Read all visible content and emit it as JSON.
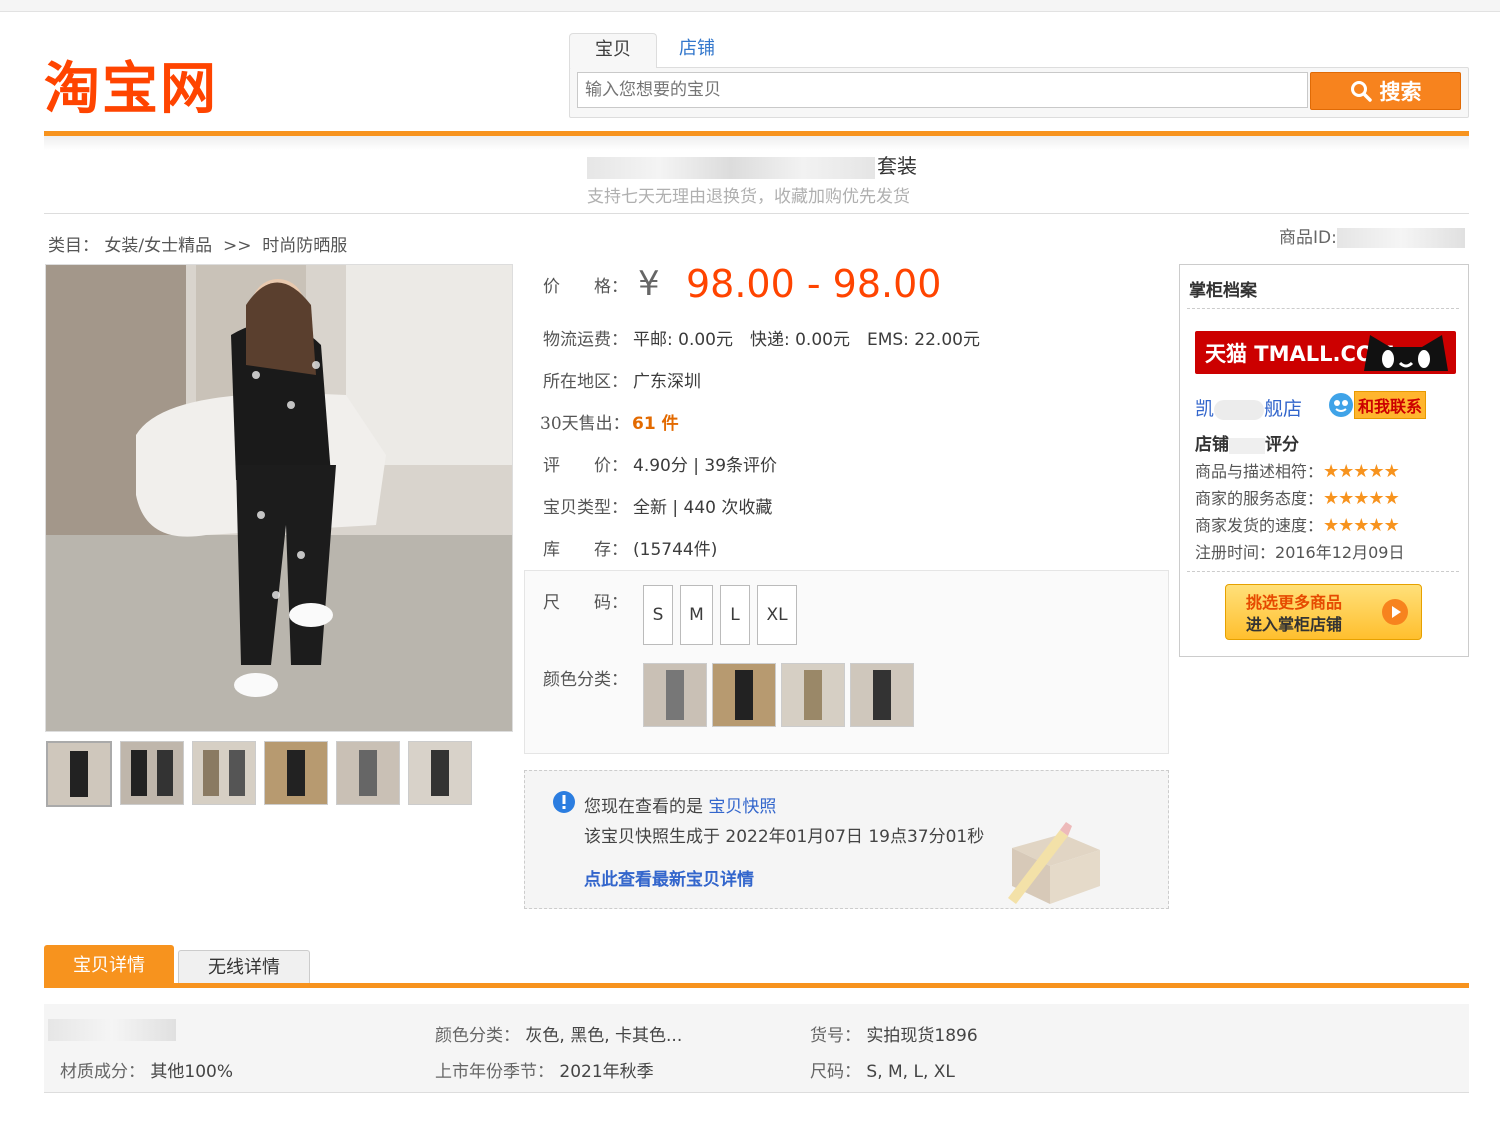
{
  "search": {
    "tab_active": "宝贝",
    "tab_inactive": "店铺",
    "placeholder": "输入您想要的宝贝",
    "button_label": "搜索"
  },
  "logo": {
    "text": "淘宝网"
  },
  "product": {
    "title_visible_suffix": "套装",
    "subtitle": "支持七天无理由退换货，收藏加购优先发货",
    "breadcrumb_label": "类目：",
    "breadcrumb_cat1": "女装/女士精品",
    "breadcrumb_sep": ">>",
    "breadcrumb_cat2": "时尚防晒服",
    "item_id_label": "商品ID:",
    "price_label": "价　　格：",
    "price_symbol": "¥",
    "price": "98.00 - 98.00",
    "shipping_label": "物流运费：",
    "shipping_value": "平邮: 0.00元　快递: 0.00元　EMS: 22.00元",
    "location_label": "所在地区：",
    "location_value": "广东深圳",
    "sold_label": "30天售出：",
    "sold_value": "61 件",
    "rating_label": "评　　价：",
    "rating_value": "4.90分 | 39条评价",
    "type_label": "宝贝类型：",
    "type_value": "全新 | 440 次收藏",
    "stock_label": "库　　存：",
    "stock_value": "(15744件)",
    "size_label": "尺　　码：",
    "sizes": [
      "S",
      "M",
      "L",
      "XL"
    ],
    "color_label": "颜色分类："
  },
  "snapshot": {
    "line1_prefix": "您现在查看的是",
    "line1_link": "宝贝快照",
    "line2": "该宝贝快照生成于 2022年01月07日 19点37分01秒",
    "link": "点此查看最新宝贝详情"
  },
  "shop": {
    "title": "掌柜档案",
    "tmall_text": "天猫 TMALL.COM",
    "shop_name_prefix": "凯",
    "shop_name_suffix": "舰店",
    "contact": "和我联系",
    "score_heading_prefix": "店铺",
    "score_heading_suffix": "评分",
    "scores": [
      {
        "label": "商品与描述相符：",
        "value": 4.5
      },
      {
        "label": "商家的服务态度：",
        "value": 4.5
      },
      {
        "label": "商家发货的速度：",
        "value": 4.5
      }
    ],
    "reg_label": "注册时间：",
    "reg_value": "2016年12月09日",
    "enter_line1": "挑选更多商品",
    "enter_line2": "进入掌柜店铺"
  },
  "tabs": {
    "detail": "宝贝详情",
    "wireless": "无线详情"
  },
  "attrs": {
    "material_label": "材质成分：",
    "material_value": "其他100%",
    "color_label": "颜色分类：",
    "color_value": "灰色, 黑色, 卡其色...",
    "season_label": "上市年份季节：",
    "season_value": "2021年秋季",
    "sku_label": "货号：",
    "sku_value": "实拍现货1896",
    "size_label": "尺码：",
    "size_value": "S, M, L, XL"
  },
  "colors": {
    "accent": "#f7931e",
    "price": "#ff4400",
    "link": "#3366cc",
    "tmall": "#cc0000"
  }
}
